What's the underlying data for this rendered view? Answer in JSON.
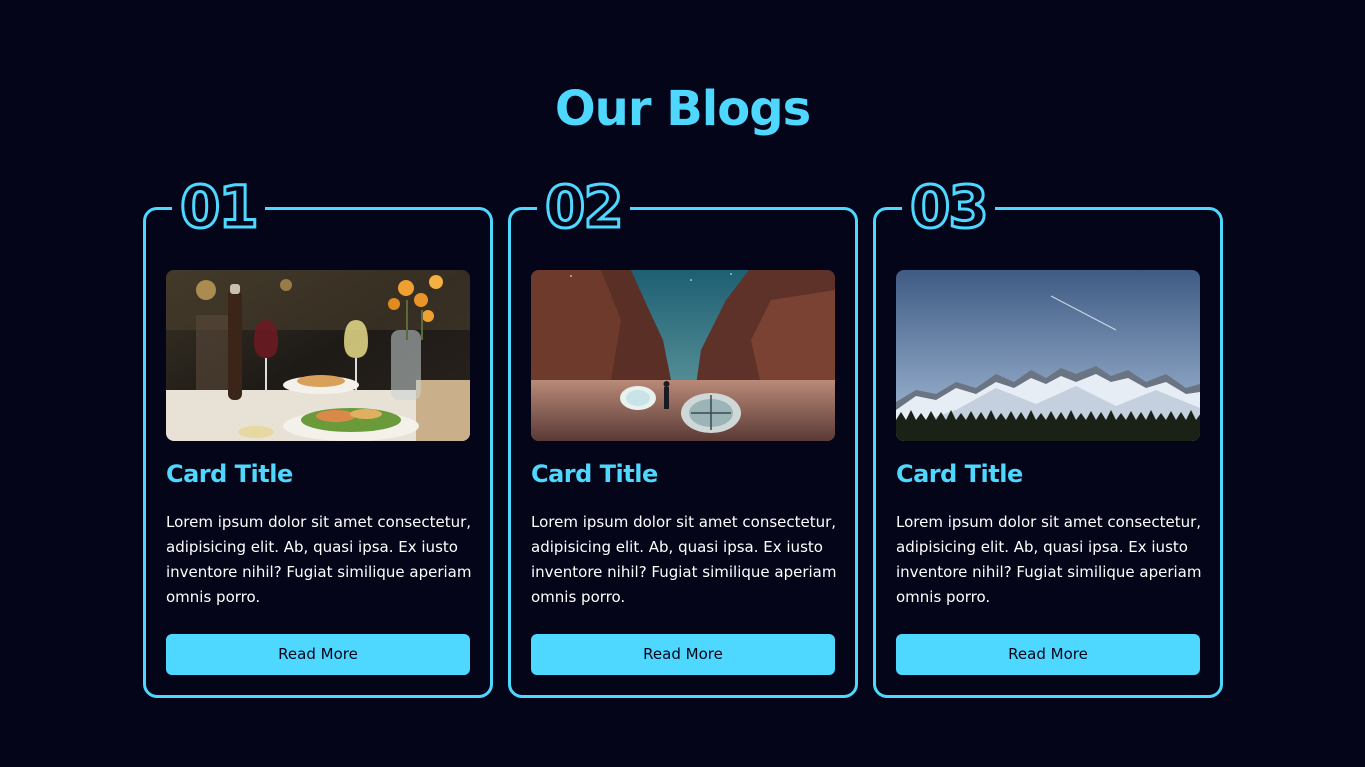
{
  "page": {
    "title": "Our Blogs"
  },
  "colors": {
    "background": "#05051a",
    "accent": "#4fd8ff",
    "text": "#ffffff"
  },
  "cards": [
    {
      "number": "01",
      "image": "restaurant-dinner-photo",
      "title": "Card Title",
      "text": "Lorem ipsum dolor sit amet consectetur, adipisicing elit. Ab, quasi ipsa. Ex iusto inventore nihil? Fugiat similique aperiam omnis porro.",
      "button": "Read More"
    },
    {
      "number": "02",
      "image": "desert-canyon-camping-photo",
      "title": "Card Title",
      "text": "Lorem ipsum dolor sit amet consectetur, adipisicing elit. Ab, quasi ipsa. Ex iusto inventore nihil? Fugiat similique aperiam omnis porro.",
      "button": "Read More"
    },
    {
      "number": "03",
      "image": "snowy-mountains-photo",
      "title": "Card Title",
      "text": "Lorem ipsum dolor sit amet consectetur, adipisicing elit. Ab, quasi ipsa. Ex iusto inventore nihil? Fugiat similique aperiam omnis porro.",
      "button": "Read More"
    }
  ]
}
